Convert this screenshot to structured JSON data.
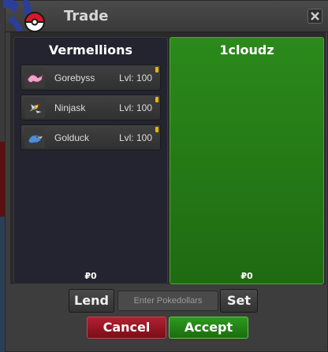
{
  "window": {
    "title": "Trade"
  },
  "left_panel": {
    "owner": "Vermellions",
    "pokemon": [
      {
        "name": "Gorebyss",
        "level": "Lvl: 100",
        "icon": "gorebyss-icon"
      },
      {
        "name": "Ninjask",
        "level": "Lvl: 100",
        "icon": "ninjask-icon"
      },
      {
        "name": "Golduck",
        "level": "Lvl: 100",
        "icon": "golduck-icon"
      }
    ],
    "money": "₽0"
  },
  "right_panel": {
    "owner": "1cloudz",
    "pokemon": [],
    "money": "₽0"
  },
  "controls": {
    "lend_label": "Lend",
    "money_placeholder": "Enter Pokedollars",
    "set_label": "Set",
    "cancel_label": "Cancel",
    "accept_label": "Accept"
  },
  "colors": {
    "right_panel_bg": "#238018",
    "cancel_bg": "#9a1625",
    "accept_bg": "#248414"
  }
}
